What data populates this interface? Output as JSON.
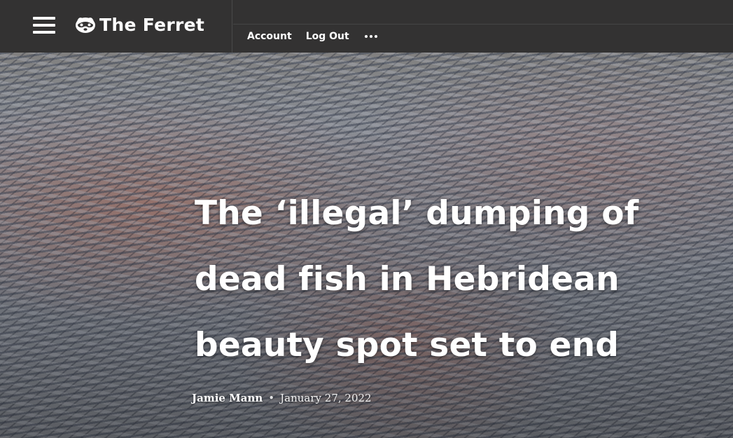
{
  "header": {
    "site_name": "The Ferret",
    "nav": {
      "account": "Account",
      "logout": "Log Out",
      "more": "···"
    }
  },
  "article": {
    "title": "The ‘illegal’ dumping of dead fish in Hebridean beauty spot set to end",
    "author": "Jamie Mann",
    "separator": "•",
    "date": "January 27, 2022"
  },
  "icons": {
    "menu": "hamburger-menu-icon",
    "logo": "ferret-logo-icon",
    "more": "more-dots-icon"
  },
  "colors": {
    "header_bg": "#333232",
    "text": "#ffffff"
  }
}
